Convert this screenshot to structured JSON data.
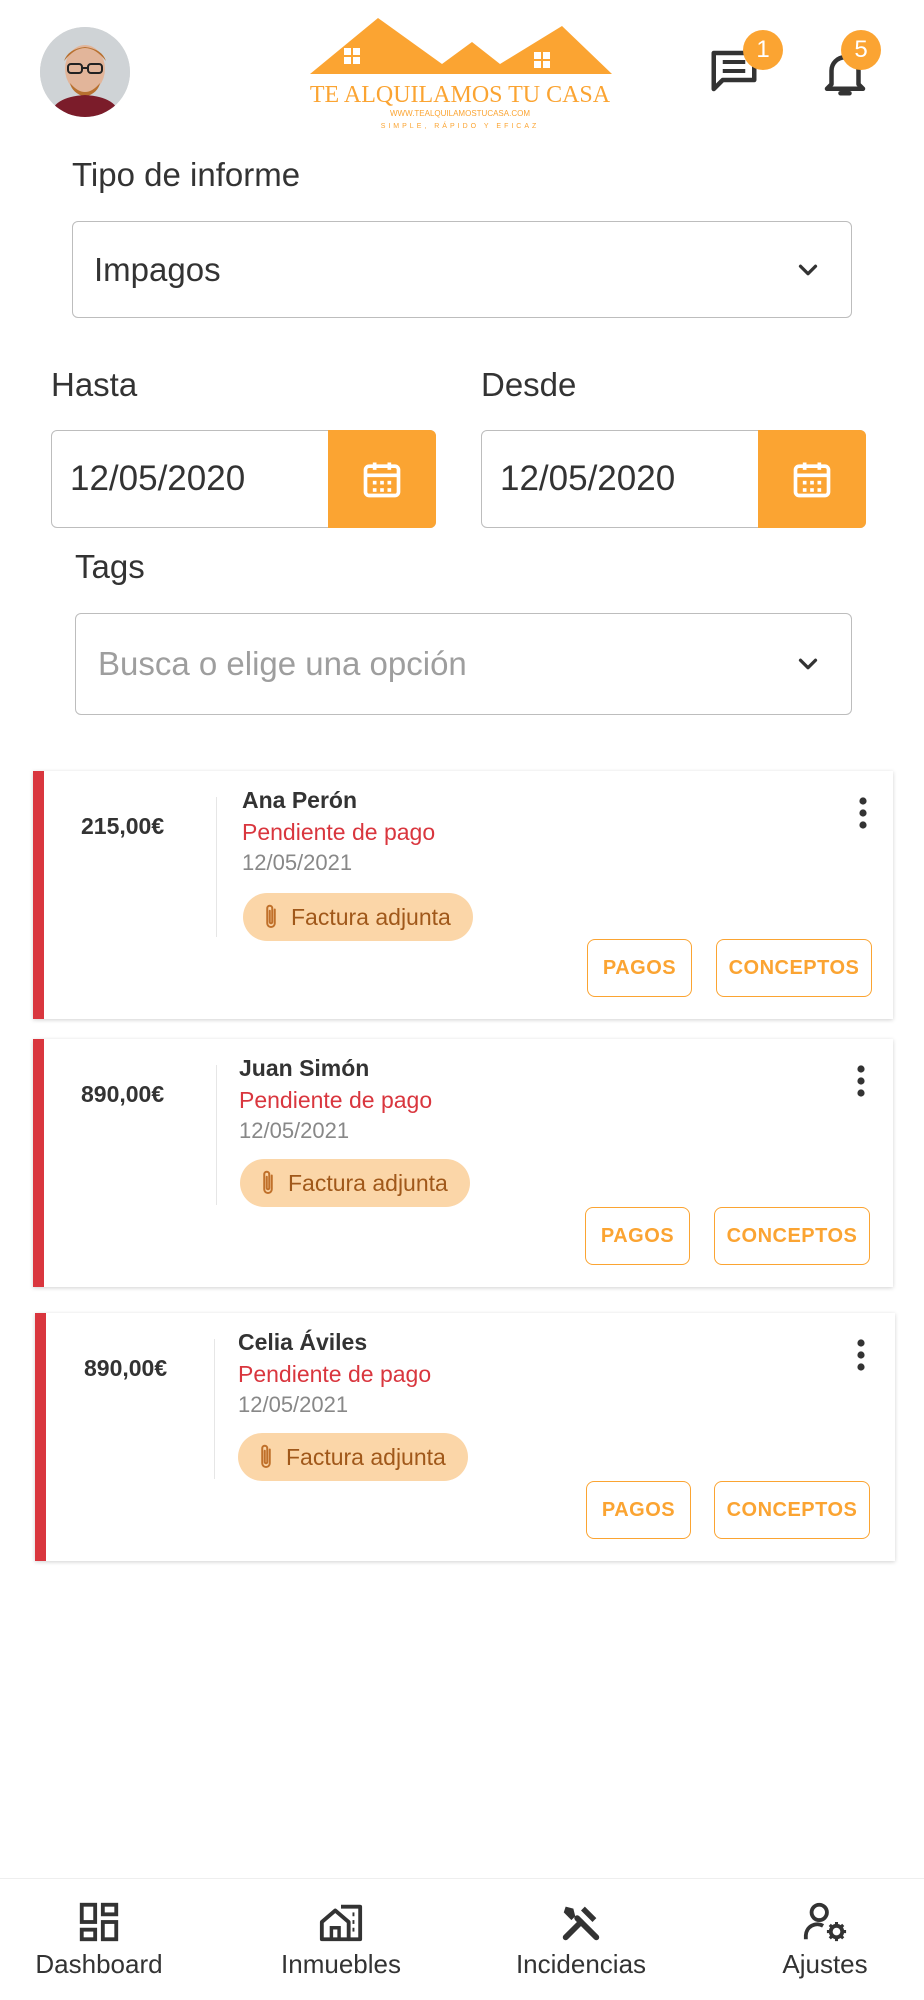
{
  "header": {
    "logo_title": "TE ALQUILAMOS TU CASA",
    "logo_url": "WWW.TEALQUILAMOSTUCASA.COM",
    "logo_tagline": "SIMPLE, RÁPIDO Y EFICAZ",
    "messages_count": "1",
    "notifications_count": "5"
  },
  "filters": {
    "report_type_label": "Tipo de informe",
    "report_type_value": "Impagos",
    "until_label": "Hasta",
    "until_value": "12/05/2020",
    "from_label": "Desde",
    "from_value": "12/05/2020",
    "tags_label": "Tags",
    "tags_placeholder": "Busca o elige una opción"
  },
  "invoices": [
    {
      "amount": "215,00€",
      "name": "Ana Perón",
      "status": "Pendiente de pago",
      "date": "12/05/2021",
      "attachment": "Factura adjunta",
      "payments_label": "PAGOS",
      "concepts_label": "CONCEPTOS"
    },
    {
      "amount": "890,00€",
      "name": "Juan Simón",
      "status": "Pendiente de pago",
      "date": "12/05/2021",
      "attachment": "Factura adjunta",
      "payments_label": "PAGOS",
      "concepts_label": "CONCEPTOS"
    },
    {
      "amount": "890,00€",
      "name": "Celia Áviles",
      "status": "Pendiente de pago",
      "date": "12/05/2021",
      "attachment": "Factura adjunta",
      "payments_label": "PAGOS",
      "concepts_label": "CONCEPTOS"
    }
  ],
  "nav": {
    "items": [
      {
        "label": "Dashboard",
        "icon": "dashboard-icon"
      },
      {
        "label": "Inmuebles",
        "icon": "building-icon"
      },
      {
        "label": "Incidencias",
        "icon": "tools-icon"
      },
      {
        "label": "Ajustes",
        "icon": "user-settings-icon"
      }
    ]
  },
  "colors": {
    "accent": "#FBA432",
    "status_red": "#D9363E",
    "chip_bg": "#FBD6A8"
  }
}
